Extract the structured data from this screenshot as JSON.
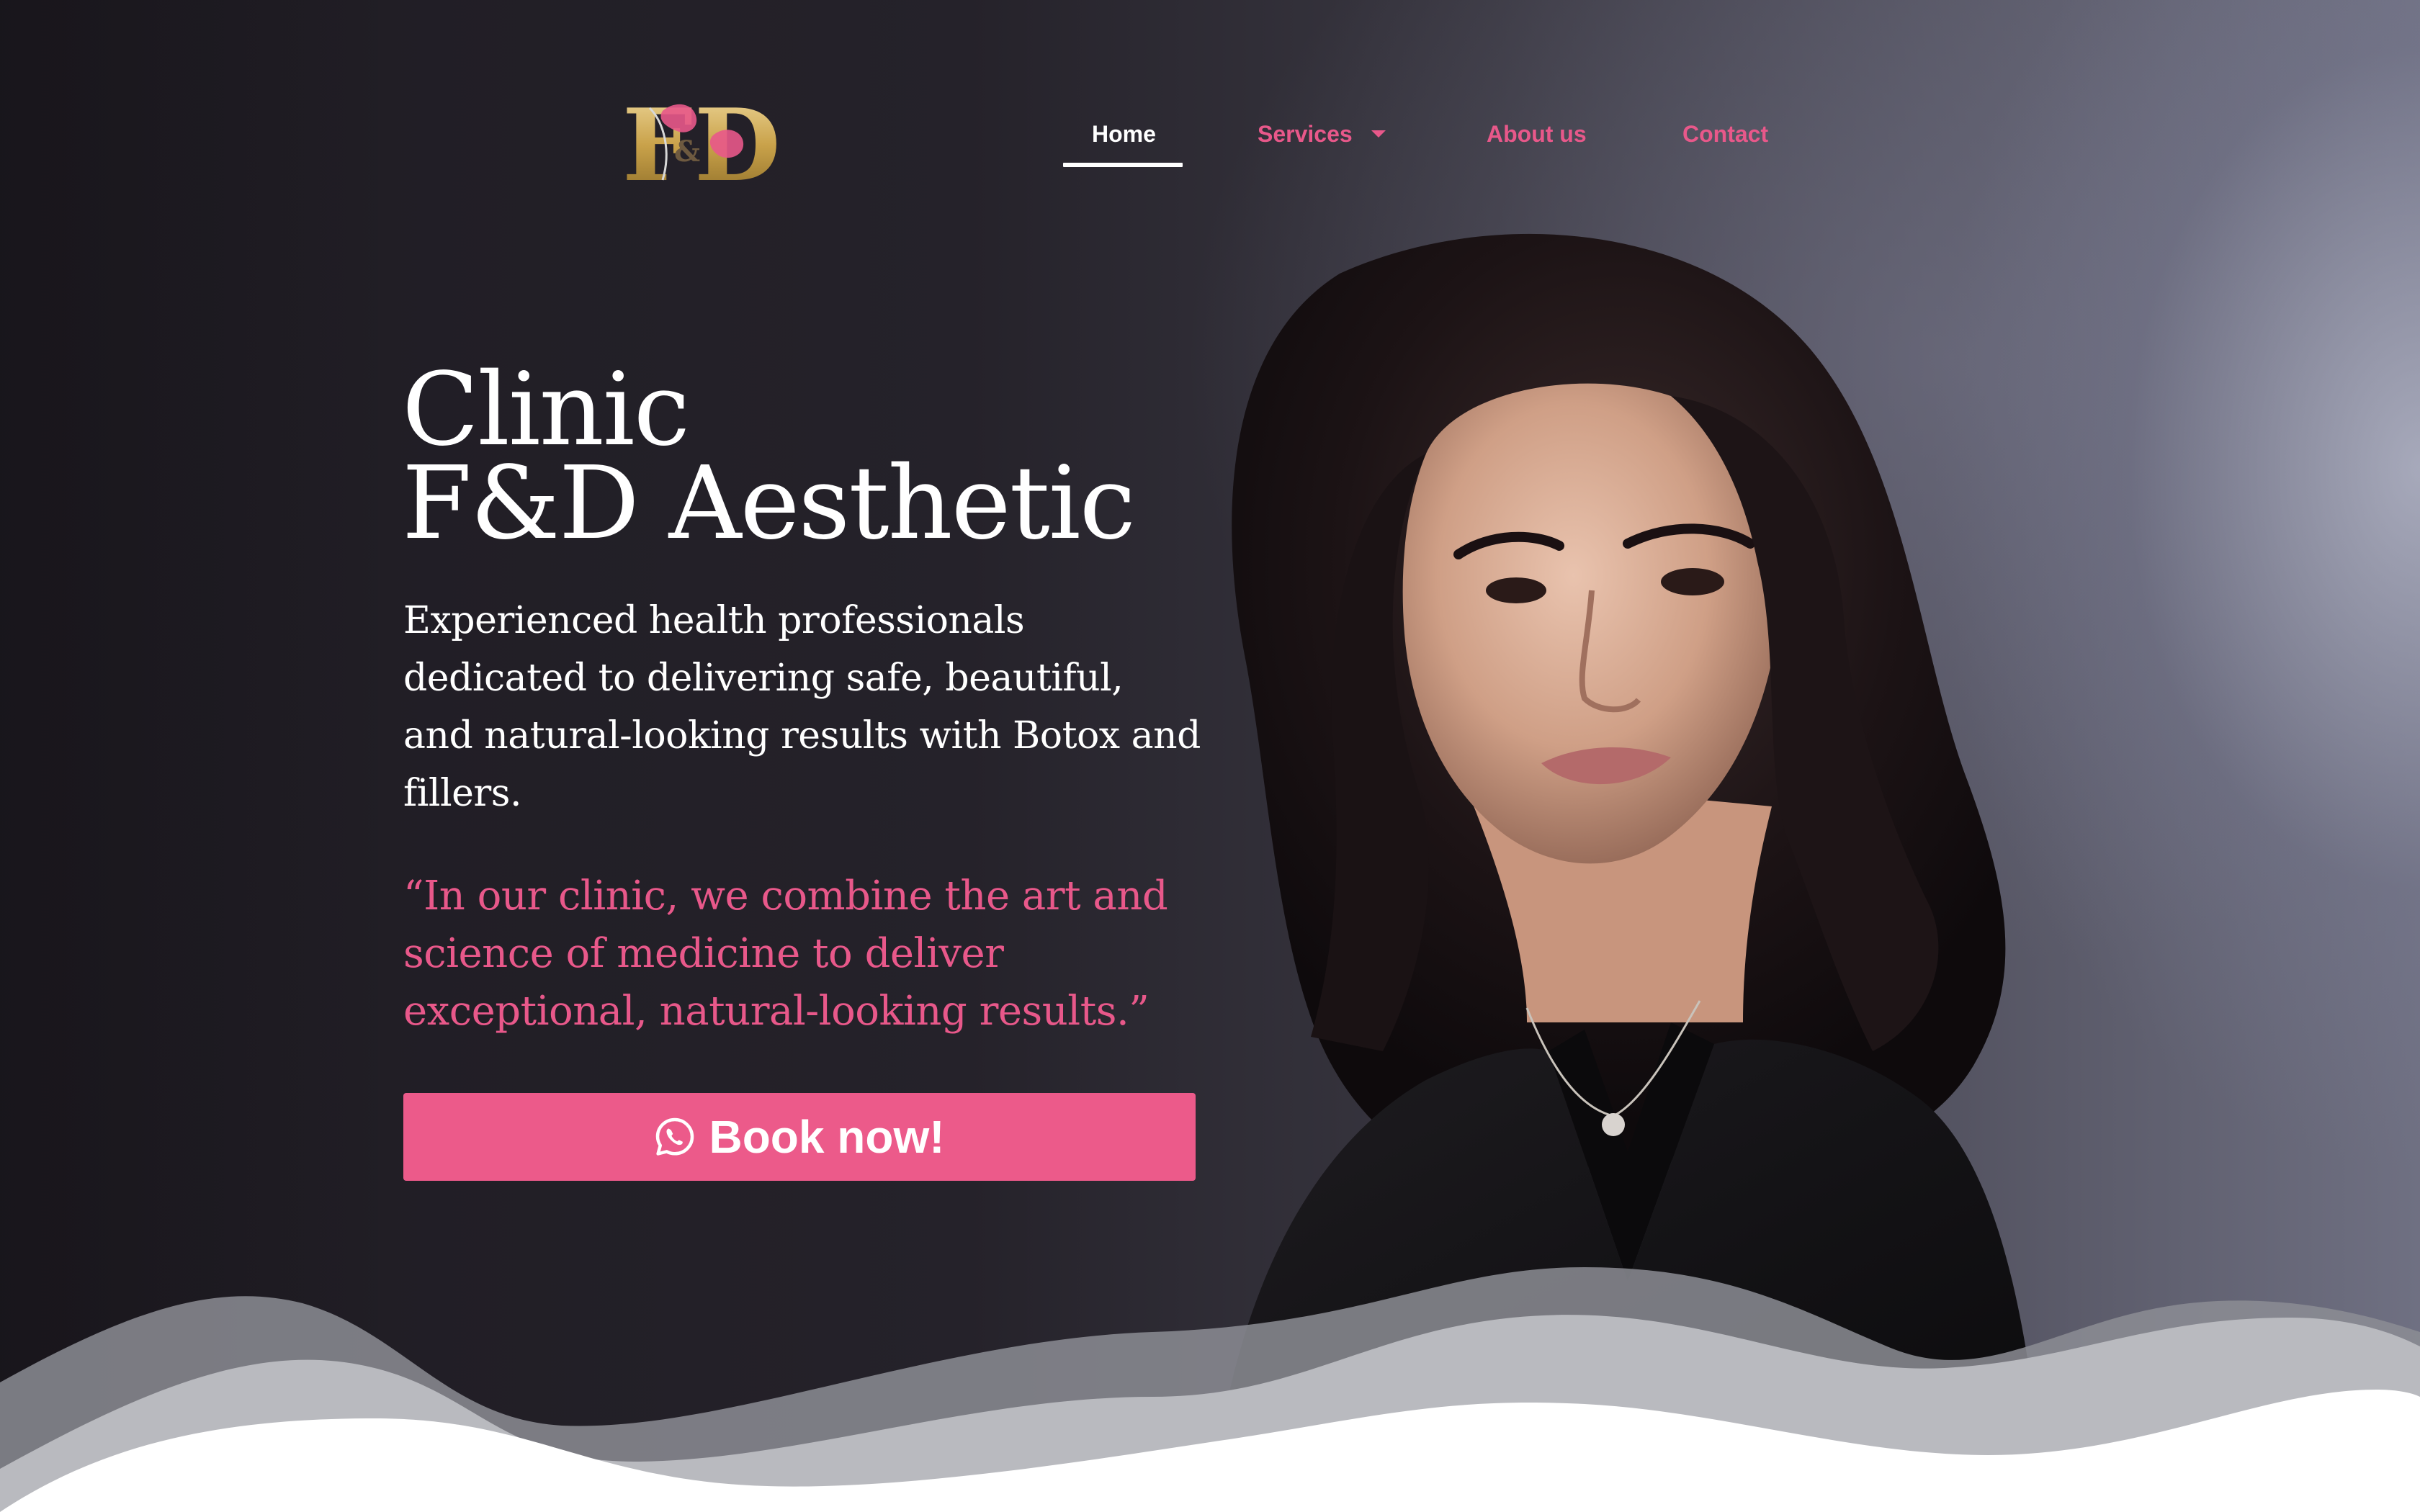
{
  "brand": {
    "logo_text": "F&D",
    "logo_inner": "&"
  },
  "nav": {
    "items": [
      {
        "label": "Home",
        "active": true
      },
      {
        "label": "Services",
        "has_dropdown": true
      },
      {
        "label": "About us"
      },
      {
        "label": "Contact"
      }
    ]
  },
  "hero": {
    "title_line1": "Clinic",
    "title_line2": "F&D Aesthetic",
    "description": "Experienced health professionals dedicated to delivering safe, beautiful, and natural-looking results with Botox and fillers.",
    "quote": "“In our clinic, we combine the art and science of medicine to deliver exceptional, natural-looking results.”",
    "cta_label": "Book now!",
    "cta_icon": "whatsapp-icon"
  },
  "colors": {
    "accent": "#ec5a8a",
    "nav_link": "#e8588a",
    "background": "#211e25",
    "text": "#ffffff",
    "logo_gold": "#c9a24a"
  }
}
